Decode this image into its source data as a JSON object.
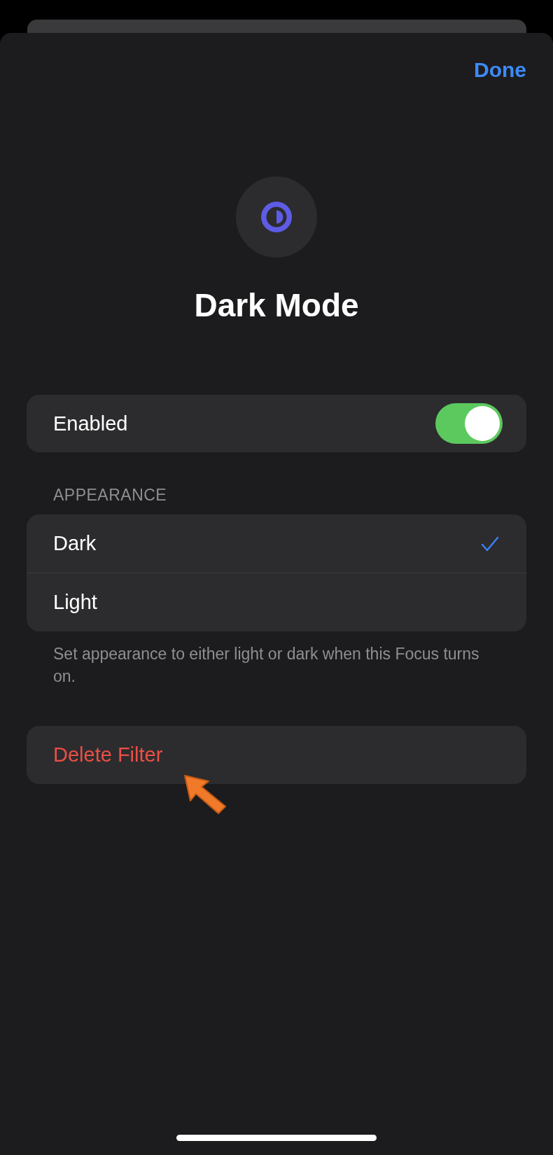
{
  "nav": {
    "done": "Done"
  },
  "header": {
    "title": "Dark Mode"
  },
  "toggle": {
    "label": "Enabled",
    "on": true
  },
  "appearance": {
    "header": "APPEARANCE",
    "options": [
      {
        "label": "Dark",
        "selected": true
      },
      {
        "label": "Light",
        "selected": false
      }
    ],
    "footer": "Set appearance to either light or dark when this Focus turns on."
  },
  "delete": {
    "label": "Delete Filter"
  }
}
